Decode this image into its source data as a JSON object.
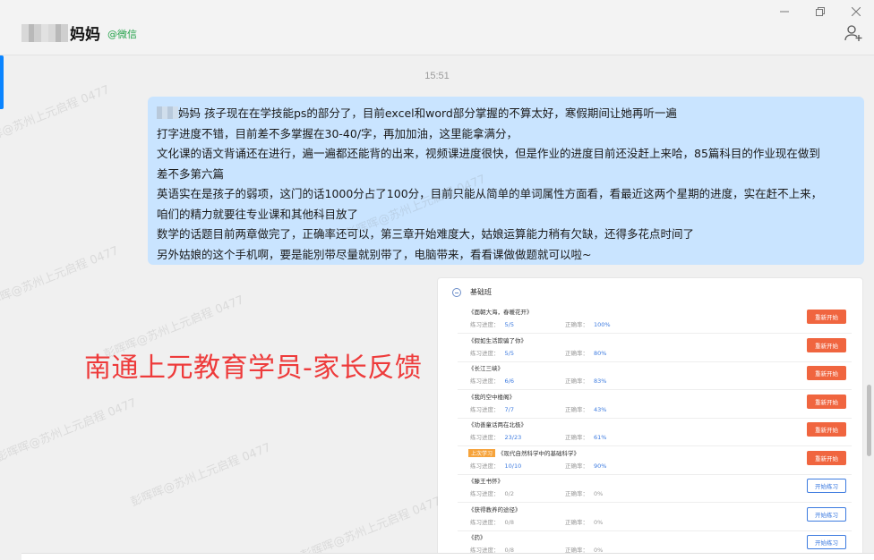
{
  "header": {
    "title": "妈妈",
    "source_tag": "@微信"
  },
  "timestamp": "15:51",
  "message": {
    "lines": [
      "妈妈 孩子现在在学技能ps的部分了，目前excel和word部分掌握的不算太好，寒假期间让她再听一遍",
      "打字进度不错，目前差不多掌握在30-40/字，再加加油，这里能拿满分，",
      "文化课的语文背诵还在进行，遍一遍都还能背的出来，视频课进度很快，但是作业的进度目前还没赶上来哈，85篇科目的作业现在做到",
      "差不多第六篇",
      "英语实在是孩子的弱项，这门的话1000分占了100分，目前只能从简单的单词属性方面看，看最近这两个星期的进度，实在赶不上来，",
      "咱们的精力就要往专业课和其他科目放了",
      "数学的话题目前两章做完了，正确率还可以，第三章开始难度大，姑娘运算能力稍有欠缺，还得多花点时间了",
      "另外姑娘的这个手机啊，要是能別带尽量就别带了，电脑带来，看看课做做题就可以啦~"
    ]
  },
  "shot": {
    "section_title": "基础班",
    "progress_label": "练习进度：",
    "accuracy_label": "正确率：",
    "courses": [
      {
        "tag": "",
        "name": "《面朝大海，春暖花开》",
        "progress": "5/5",
        "accuracy": "100%",
        "button": "重新开始",
        "btn_type": "redo",
        "acc_color": "blue"
      },
      {
        "tag": "",
        "name": "《假如生活欺骗了你》",
        "progress": "5/5",
        "accuracy": "80%",
        "button": "重新开始",
        "btn_type": "redo",
        "acc_color": "blue"
      },
      {
        "tag": "",
        "name": "《长江三峡》",
        "progress": "6/6",
        "accuracy": "83%",
        "button": "重新开始",
        "btn_type": "redo",
        "acc_color": "blue"
      },
      {
        "tag": "",
        "name": "《我的空中楼阁》",
        "progress": "7/7",
        "accuracy": "43%",
        "button": "重新开始",
        "btn_type": "redo",
        "acc_color": "blue"
      },
      {
        "tag": "",
        "name": "《劝善童话两在北极》",
        "progress": "23/23",
        "accuracy": "61%",
        "button": "重新开始",
        "btn_type": "redo",
        "acc_color": "blue"
      },
      {
        "tag": "上次学习",
        "name": "《现代自然科学中的基础科学》",
        "progress": "10/10",
        "accuracy": "90%",
        "button": "重新开始",
        "btn_type": "redo",
        "acc_color": "blue"
      },
      {
        "tag": "",
        "name": "《滕王书怀》",
        "progress": "0/2",
        "accuracy": "0%",
        "button": "开始练习",
        "btn_type": "start",
        "acc_color": "gray"
      },
      {
        "tag": "",
        "name": "《获得教养的途径》",
        "progress": "0/8",
        "accuracy": "0%",
        "button": "开始练习",
        "btn_type": "start",
        "acc_color": "gray"
      },
      {
        "tag": "",
        "name": "《药》",
        "progress": "0/8",
        "accuracy": "0%",
        "button": "开始练习",
        "btn_type": "start",
        "acc_color": "gray"
      }
    ]
  },
  "caption": "南通上元教育学员-家长反馈",
  "watermark": "彭晖晖@苏州上元启程 0477",
  "colors": {
    "bubble": "#c9e4ff",
    "caption": "#ee3b3b",
    "wechat_tag": "#24a24a",
    "redo_button": "#f0653f",
    "start_button": "#3d7be0"
  }
}
